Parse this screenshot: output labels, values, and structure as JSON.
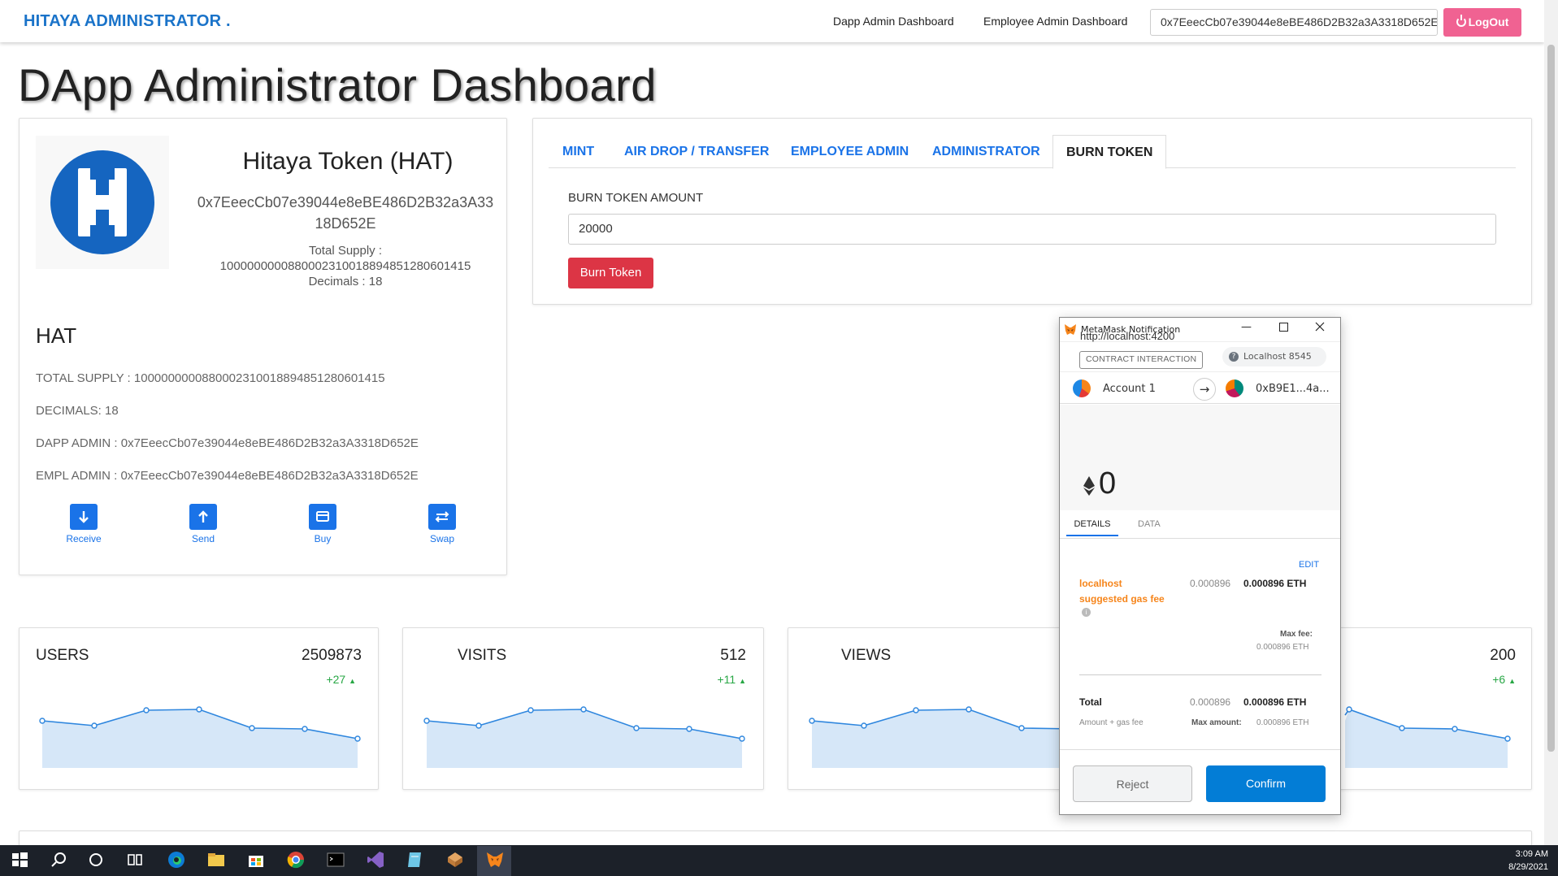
{
  "navbar": {
    "brand": "HITAYA ADMINISTRATOR .",
    "links": [
      "Dapp Admin Dashboard",
      "Employee Admin Dashboard"
    ],
    "address": "0x7EeecCb07e39044e8eBE486D2B32a3A3318D652E",
    "logout_label": "LogOut"
  },
  "page_title": "DApp Administrator Dashboard",
  "token": {
    "name": "Hitaya Token (HAT)",
    "address": "0x7EeecCb07e39044e8eBE486D2B32a3A3318D652E",
    "total_supply_label": "Total Supply :",
    "total_supply_value": "1000000000880002310018894851280601415",
    "decimals_line": "Decimals : 18",
    "symbol": "HAT",
    "info": [
      "TOTAL SUPPLY : 1000000000880002310018894851280601415",
      "DECIMALS: 18",
      "DAPP ADMIN : 0x7EeecCb07e39044e8eBE486D2B32a3A3318D652E",
      "EMPL ADMIN : 0x7EeecCb07e39044e8eBE486D2B32a3A3318D652E"
    ],
    "actions": [
      "Receive",
      "Send",
      "Buy",
      "Swap"
    ]
  },
  "tabs": {
    "items": [
      "MINT",
      "AIR DROP / TRANSFER",
      "EMPLOYEE ADMIN",
      "ADMINISTRATOR",
      "BURN TOKEN"
    ],
    "active": "BURN TOKEN"
  },
  "burn": {
    "label": "BURN TOKEN AMOUNT",
    "value": "20000",
    "button": "Burn Token"
  },
  "stats": [
    {
      "title": "USERS",
      "value": "2509873",
      "delta": "+27"
    },
    {
      "title": "VISITS",
      "value": "512",
      "delta": "+11"
    },
    {
      "title": "VIEWS",
      "value": "",
      "delta": ""
    },
    {
      "title": "",
      "value": "200",
      "delta": "+6"
    }
  ],
  "metamask": {
    "window_title": "MetaMask Notification",
    "network": "Localhost 8545",
    "from_account": "Account 1",
    "to_account": "0xB9E1...4a...",
    "origin": "http://localhost:4200",
    "chip": "CONTRACT INTERACTION",
    "amount": "0",
    "tabs": [
      "DETAILS",
      "DATA"
    ],
    "edit": "EDIT",
    "gas_label_1": "localhost",
    "gas_label_2": "suggested gas fee",
    "gas_value_gray": "0.000896",
    "gas_value_bold": "0.000896 ETH",
    "max_fee_label": "Max fee:",
    "max_fee_value": "0.000896 ETH",
    "total_label": "Total",
    "total_gray": "0.000896",
    "total_bold": "0.000896 ETH",
    "amount_gas_label": "Amount + gas fee",
    "max_amount_label": "Max amount:",
    "max_amount_value": "0.000896 ETH",
    "reject": "Reject",
    "confirm": "Confirm"
  },
  "taskbar": {
    "time": "3:09 AM",
    "date": "8/29/2021"
  },
  "colors": {
    "brand": "#1a73c9",
    "link_blue": "#1a73e8",
    "logout_pink": "#f06292",
    "burn_red": "#dc3545",
    "positive_green": "#28a745",
    "metamask_orange": "#f6851b"
  }
}
